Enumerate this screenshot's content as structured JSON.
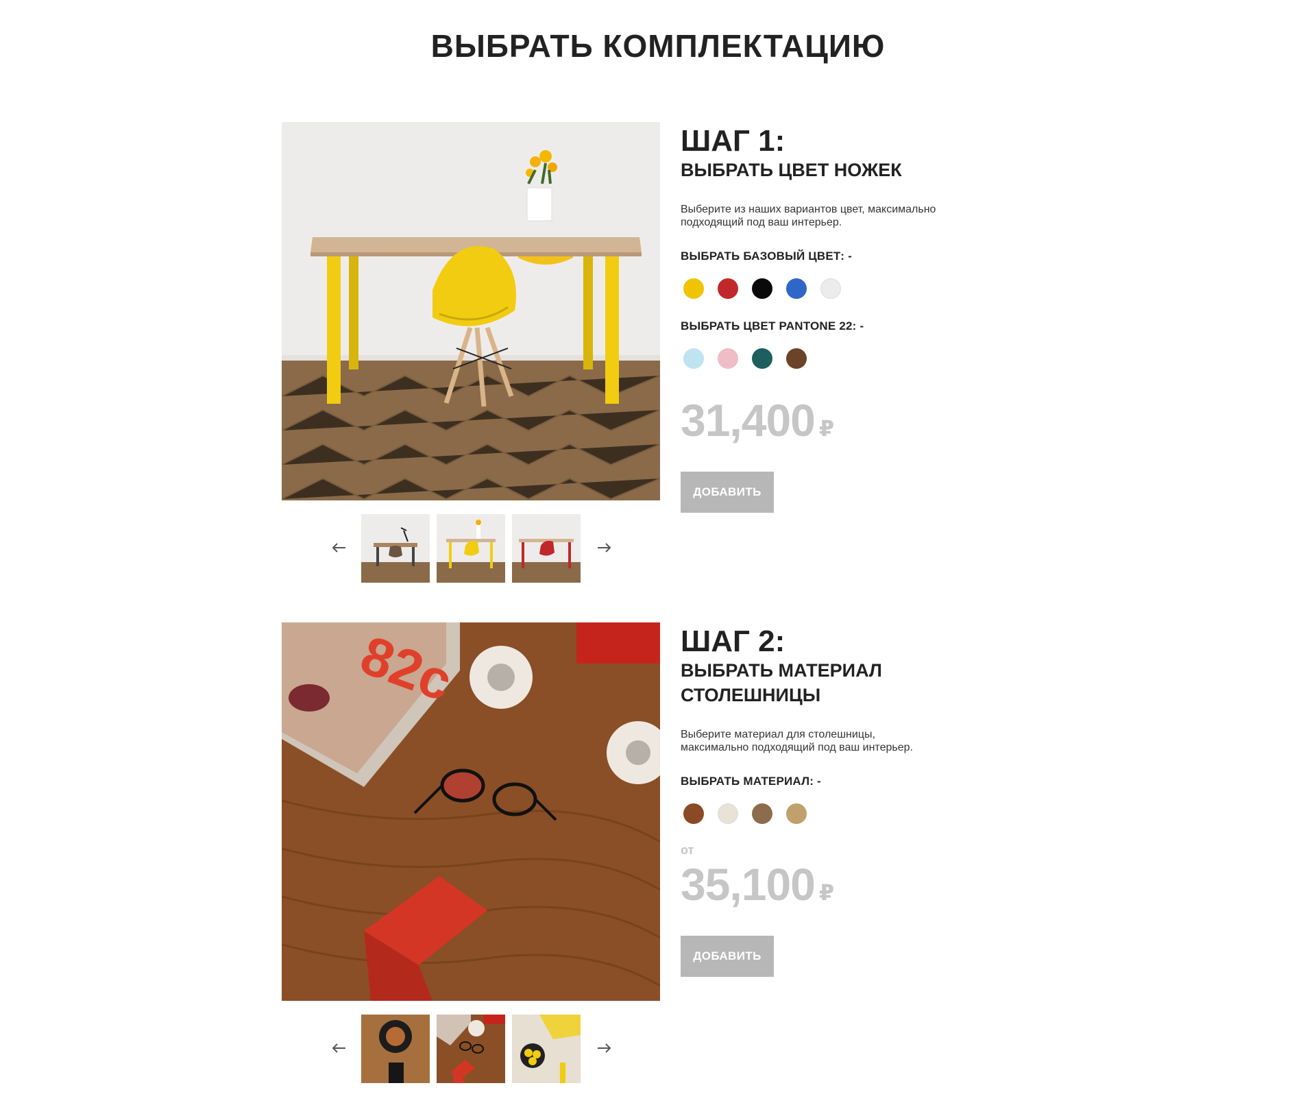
{
  "page": {
    "title": "ВЫБРАТЬ КОМПЛЕКТАЦИЮ"
  },
  "steps": [
    {
      "number": "ШАГ 1:",
      "subtitle": "ВЫБРАТЬ ЦВЕТ НОЖЕК",
      "description": "Выберите из наших вариантов цвет, максимально подходящий под ваш интерьер.",
      "groups": [
        {
          "label": "ВЫБРАТЬ БАЗОВЫЙ ЦВЕТ: -",
          "colors": [
            "#f0c400",
            "#c0282a",
            "#0a0a0a",
            "#2f67c8",
            "#ececec"
          ]
        },
        {
          "label": "ВЫБРАТЬ ЦВЕТ PANTONE 22: -",
          "colors": [
            "#bfe3f0",
            "#f0bcc6",
            "#1d5e5f",
            "#6b4328"
          ]
        }
      ],
      "price_from": "",
      "price": "31,400",
      "currency": "₽",
      "button": "ДОБАВИТЬ"
    },
    {
      "number": "ШАГ 2:",
      "subtitle": "ВЫБРАТЬ МАТЕРИАЛ СТОЛЕШНИЦЫ",
      "description": "Выберите материал для столешницы, максимально подходящий под ваш интерьер.",
      "groups": [
        {
          "label": "ВЫБРАТЬ МАТЕРИАЛ: -",
          "colors": [
            "#8a4a26",
            "#e8e3d6",
            "#8c6c4c",
            "#c0a06c"
          ]
        }
      ],
      "price_from": "от",
      "price": "35,100",
      "currency": "₽",
      "button": "ДОБАВИТЬ"
    }
  ],
  "icons": {
    "prev": "arrow-left-icon",
    "next": "arrow-right-icon"
  },
  "colors": {
    "price": "#c6c6c6",
    "button": "#b7b7b7",
    "text": "#222222"
  }
}
